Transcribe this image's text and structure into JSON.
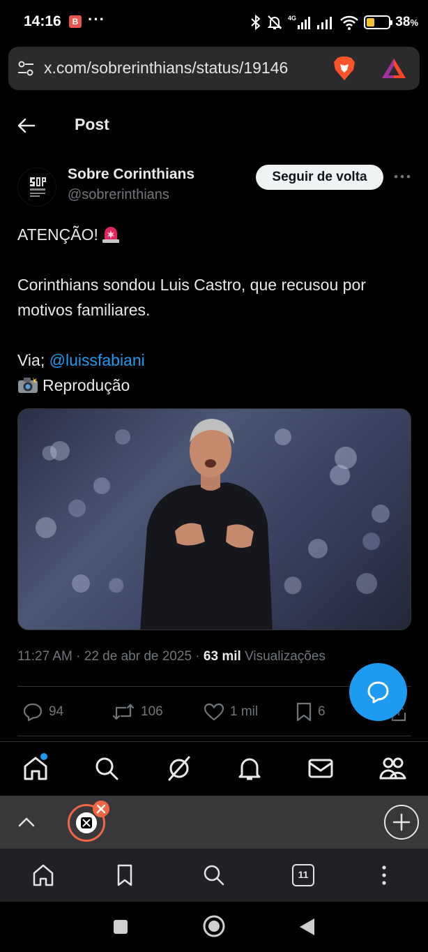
{
  "status_bar": {
    "time": "14:16",
    "app_badge": "B",
    "overflow": "···",
    "network": "4G",
    "battery_percent_label": "38",
    "battery_percent_sign": "%",
    "battery_level": 0.38,
    "battery_color": "#f4c430"
  },
  "browser": {
    "url": "x.com/sobrerinthians/status/19146",
    "shield_icon": "brave-lion-icon",
    "rewards_icon": "brave-rewards-triangle-icon"
  },
  "header": {
    "title": "Post"
  },
  "author": {
    "name": "Sobre Corinthians",
    "handle": "@sobrerinthians",
    "follow_label": "Seguir de volta"
  },
  "tweet": {
    "line1": "ATENÇÃO!",
    "line2": "Corinthians sondou Luis Castro, que recusou por motivos familiares.",
    "via_prefix": "Via;",
    "mention": "@luissfabiani",
    "credit": "Reprodução"
  },
  "meta": {
    "time": "11:27 AM",
    "sep1": "·",
    "date": "22 de abr de 2025",
    "sep2": "·",
    "views_count": "63 mil",
    "views_label": "Visualizações"
  },
  "actions": {
    "replies": "94",
    "reposts": "106",
    "likes": "1 mil",
    "bookmarks": "6"
  },
  "browser_tabs": {
    "count": "11"
  },
  "colors": {
    "accent": "#1d9bf0",
    "tab_highlight": "#f06543"
  }
}
